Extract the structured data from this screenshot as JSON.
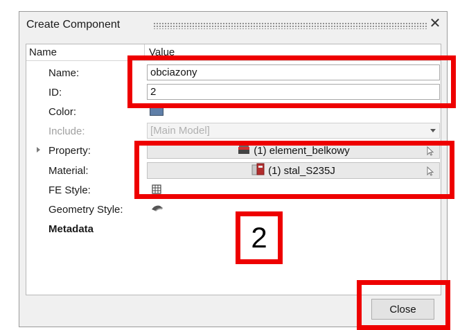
{
  "dialog": {
    "title": "Create Component"
  },
  "panel": {
    "header": {
      "name": "Name",
      "value": "Value"
    },
    "rows": {
      "name": {
        "label": "Name:",
        "value": "obciazony"
      },
      "id": {
        "label": "ID:",
        "value": "2"
      },
      "color": {
        "label": "Color:",
        "value": "#5f7fa8"
      },
      "include": {
        "label": "Include:",
        "value": "[Main Model]"
      },
      "property": {
        "label": "Property:",
        "value": "(1) element_belkowy"
      },
      "material": {
        "label": "Material:",
        "value": "(1) stal_S235J"
      },
      "fe_style": {
        "label": "FE Style:"
      },
      "geometry_style": {
        "label": "Geometry Style:"
      },
      "metadata": {
        "label": "Metadata"
      }
    }
  },
  "buttons": {
    "close": "Close"
  },
  "annotations": {
    "step_number": "2",
    "color": "#ee0000"
  },
  "icons": [
    "close-icon",
    "expand-arrow-icon",
    "property-icon",
    "material-icon",
    "cursor-pick-icon",
    "fe-style-icon",
    "geometry-style-icon"
  ]
}
